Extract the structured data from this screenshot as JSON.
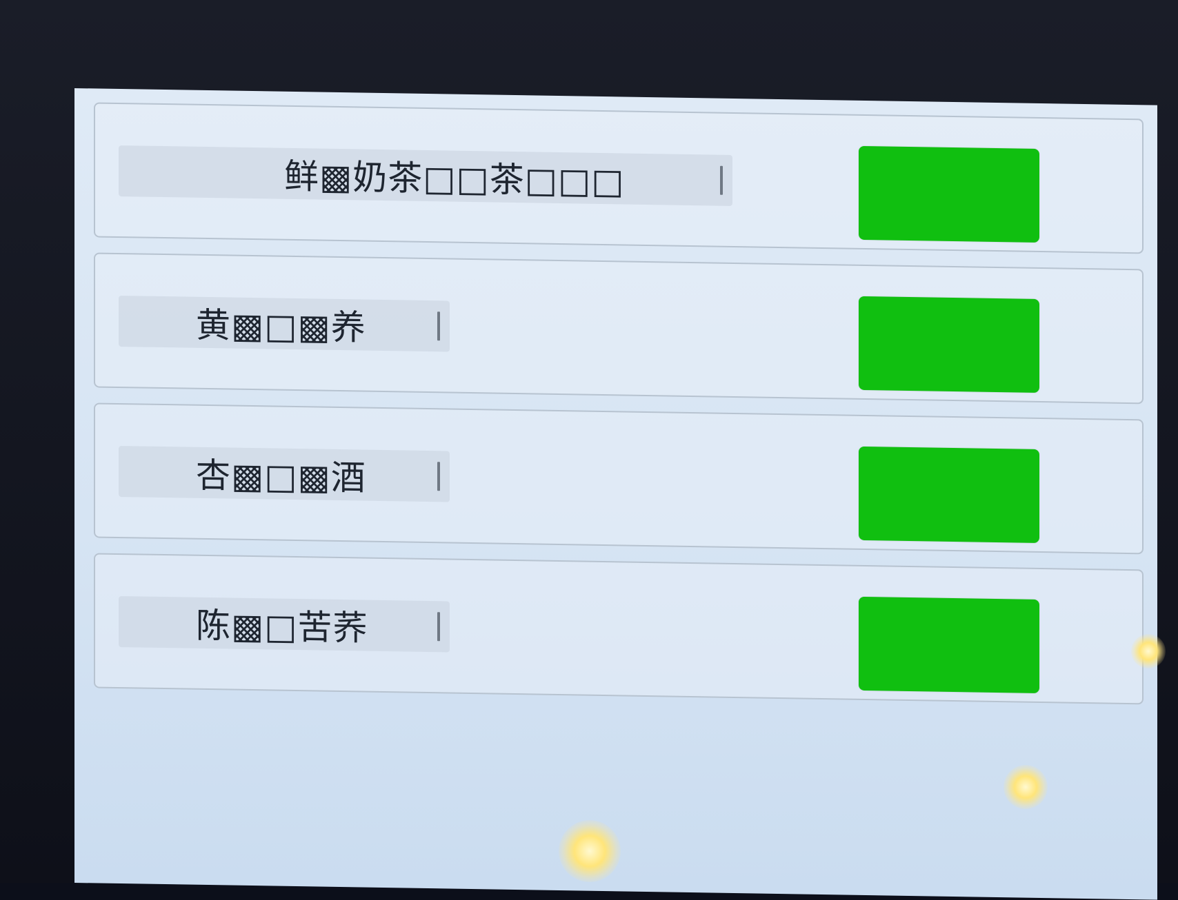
{
  "menu": {
    "items": [
      {
        "name": "鲜▩奶茶□□茶□□□",
        "button_label": ""
      },
      {
        "name": "黄▩□▩养",
        "button_label": ""
      },
      {
        "name": "杏▩□▩酒",
        "button_label": ""
      },
      {
        "name": "陈▩□苦荞",
        "button_label": ""
      }
    ]
  },
  "colors": {
    "button_green": "#10bf10",
    "screen_background": "#dfeaf6",
    "item_border": "#b7c3d0"
  }
}
